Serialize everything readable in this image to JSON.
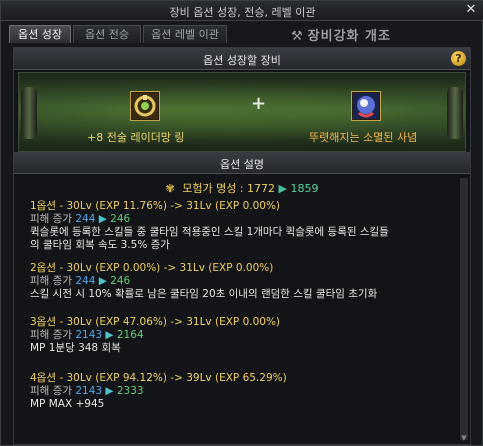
{
  "window": {
    "title": "장비 옵션 성장, 전승, 레벨 이관"
  },
  "tabs": [
    {
      "label": "옵션 성장",
      "active": true
    },
    {
      "label": "옵션 전승",
      "active": false
    },
    {
      "label": "옵션 레벨 이관",
      "active": false
    }
  ],
  "background_label": "장비강화 개조",
  "equip_section": {
    "title": "옵션 성장할 장비",
    "help": "?",
    "plus": "+",
    "left_item_name": "+8 전술 레이더망 링",
    "right_item_name": "뚜렷해지는 소멸된 사념"
  },
  "desc_section": {
    "title": "옵션 설명",
    "fame": {
      "label": "모험가 명성 : 1772",
      "arrow": "▶",
      "new_value": "1859"
    },
    "options": [
      {
        "header": "1옵션 - 30Lv (EXP 11.76%) -> 31Lv (EXP 0.00%)",
        "damage_label": "피해 증가",
        "damage_old": "244",
        "damage_arrow": "▶",
        "damage_new": "246",
        "lines": [
          "퀵슬롯에 등록한 스킬들 중 쿨타임 적용중인 스킬 1개마다 퀵슬롯에 등록된 스킬들",
          "의 쿨타임 회복 속도 3.5% 증가"
        ]
      },
      {
        "header": "2옵션 - 30Lv (EXP 0.00%) -> 31Lv (EXP 0.00%)",
        "damage_label": "피해 증가",
        "damage_old": "244",
        "damage_arrow": "▶",
        "damage_new": "246",
        "lines": [
          "스킬 시전 시 10% 확률로 남은 쿨타임 20초 이내의 랜덤한 스킬 쿨타임 초기화"
        ]
      },
      {
        "header": "3옵션 - 30Lv (EXP 47.06%) -> 31Lv (EXP 0.00%)",
        "damage_label": "피해 증가",
        "damage_old": "2143",
        "damage_arrow": "▶",
        "damage_new": "2164",
        "lines": [
          "MP 1분당 348 회복"
        ]
      },
      {
        "header": "4옵션 - 30Lv (EXP 94.12%) -> 39Lv (EXP 65.29%)",
        "damage_label": "피해 증가",
        "damage_old": "2143",
        "damage_arrow": "▶",
        "damage_new": "2333",
        "lines": [
          "MP MAX +945"
        ]
      }
    ]
  },
  "colors": {
    "accent_yellow": "#f0d060",
    "accent_green": "#68cc78",
    "accent_blue": "#4fa8e8",
    "arrow_cyan": "#4fc4c8"
  },
  "icons": {
    "close": "close-icon",
    "help": "help-icon",
    "left_item": "ring-item-icon",
    "right_item": "soul-item-icon",
    "fame": "fame-emblem-icon"
  }
}
